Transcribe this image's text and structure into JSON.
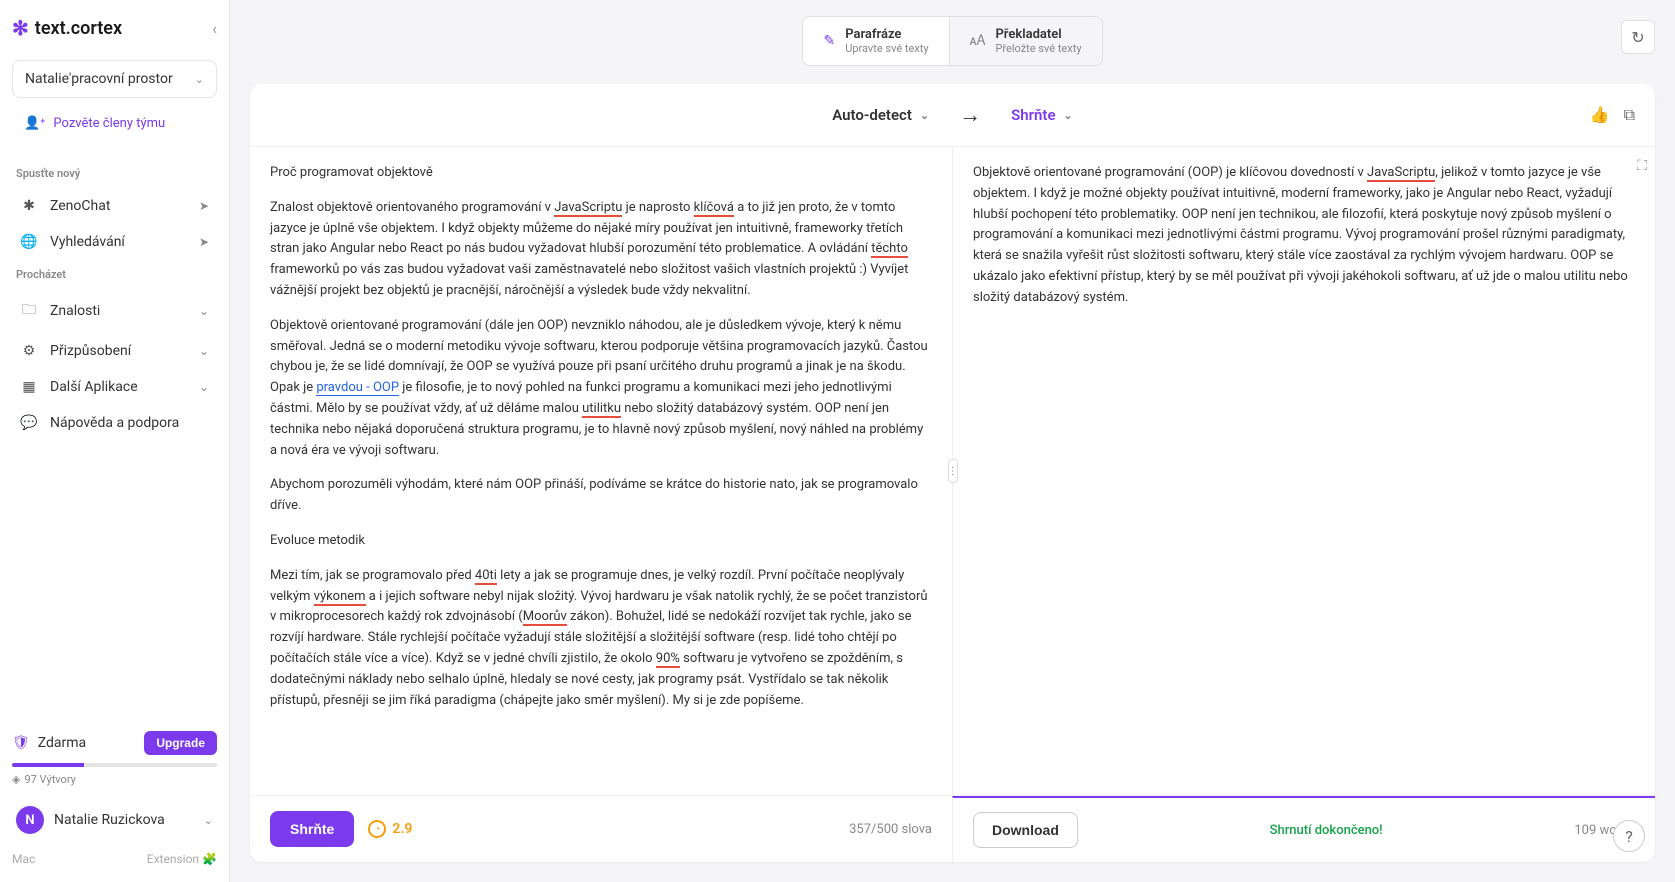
{
  "brand": "text.cortex",
  "workspace": {
    "name": "Natalie'pracovní prostor"
  },
  "invite": "Pozvěte členy týmu",
  "sections": {
    "start_new": "Spusťte nový",
    "browse": "Procházet"
  },
  "nav": {
    "zenochat": "ZenoChat",
    "search": "Vyhledávání",
    "knowledge": "Znalosti",
    "customize": "Přizpůsobení",
    "more_apps": "Další Aplikace",
    "help": "Nápověda a podpora"
  },
  "plan": {
    "name": "Zdarma",
    "upgrade": "Upgrade",
    "creations": "97 Výtvory"
  },
  "user": {
    "initial": "N",
    "name": "Natalie Ruzickova"
  },
  "footer": {
    "mac": "Mac",
    "extension": "Extension"
  },
  "tabs": {
    "paraphrase": {
      "title": "Parafráze",
      "sub": "Upravte své texty"
    },
    "translator": {
      "title": "Překladatel",
      "sub": "Přeložte své texty"
    }
  },
  "header": {
    "auto_detect": "Auto-detect",
    "summarize": "Shrňte"
  },
  "input_text": {
    "h1": "Proč programovat objektově",
    "p1a": "Znalost objektově orientovaného programování v ",
    "p1_js": "JavaScriptu",
    "p1b": " je naprosto ",
    "p1_kl": "klíčová",
    "p1c": " a to již jen proto, že v tomto jazyce je úplně vše objektem. I když objekty můžeme do nějaké míry používat jen intuitivně, frameworky třetích stran jako Angular nebo React po nás budou vyžadovat hlubší porozumění této problematice. A ovládání ",
    "p1_te": "těchto",
    "p1d": " frameworků po vás zas budou vyžadovat vaši zaměstnavatelé nebo složitost vašich vlastních projektů :) Vyvíjet vážnější projekt bez objektů je pracnější, náročnější a výsledek bude vždy nekvalitní.",
    "p2a": "Objektově orientované programování (dále jen OOP) nevzniklo náhodou, ale je důsledkem vývoje, který k němu směřoval. Jedná se o moderní metodiku vývoje softwaru, kterou podporuje většina programovacích jazyků. Častou chybou je, že se lidé domnívají, že OOP se využívá pouze při psaní určitého druhu programů a jinak je na škodu. Opak je ",
    "p2_pr": "pravdou - OOP",
    "p2b": " je filosofie, je to nový pohled na funkci programu a komunikaci mezi jeho jednotlivými částmi. Mělo by se používat vždy, ať už děláme malou ",
    "p2_ut": "utilitku",
    "p2c": " nebo složitý databázový systém. OOP není jen technika nebo nějaká doporučená struktura programu, je to hlavně nový způsob myšlení, nový náhled na problémy a nová éra ve vývoji softwaru.",
    "p3": "Abychom porozuměli výhodám, které nám OOP přináší, podíváme se krátce do historie nato, jak se programovalo dříve.",
    "h2": "Evoluce metodik",
    "p4a": "Mezi tím, jak se programovalo před ",
    "p4_40": "40ti",
    "p4b": " lety a jak se programuje dnes, je velký rozdíl. První počítače neoplývaly velkým ",
    "p4_vy": "výkonem",
    "p4c": " a i jejich software nebyl nijak složitý. Vývoj hardwaru je však natolik rychlý, že se počet tranzistorů v mikroprocesorech každý rok zdvojnásobí (",
    "p4_mo": "Moorův",
    "p4d": " zákon). Bohužel, lidé se nedokáží rozvíjet tak rychle, jako se rozvíjí hardware. Stále rychlejší počítače vyžadují stále složitější a složitější software (resp. lidé toho chtějí po počítačích stále více a více). Když se v jedné chvíli zjistilo, že okolo ",
    "p4_90": "90%",
    "p4e": " softwaru je vytvořeno se zpožděním, s dodatečnými náklady nebo selhalo úplně, hledaly se nové cesty, jak programy psát. Vystřídalo se tak několik přístupů, přesněji se jim říká paradigma (chápejte jako směr myšlení). My si je zde popíšeme."
  },
  "output_text": {
    "p1a": "Objektově orientované programování (OOP) je klíčovou dovedností v ",
    "p1_js": "JavaScriptu",
    "p1b": ", jelikož v tomto jazyce je vše objektem. I když je možné objekty používat intuitivně, moderní frameworky, jako je Angular nebo React, vyžadují hlubší pochopení této problematiky. OOP není jen technikou, ale filozofií, která poskytuje nový způsob myšlení o programování a komunikaci mezi jednotlivými částmi programu. Vývoj programování prošel různými paradigmaty, která se snažila vyřešit růst složitosti softwaru, který stále více zaostával za rychlým vývojem hardwaru. OOP se ukázalo jako efektivní přístup, který by se měl používat při vývoji jakéhokoli softwaru, ať už jde o malou utilitu nebo složitý databázový systém."
  },
  "footer_bar": {
    "summarize_btn": "Shrňte",
    "score": "2.9",
    "word_count_left": "357/500 slova",
    "download": "Download",
    "status": "Shrnutí dokončeno!",
    "word_count_right": "109 words"
  }
}
